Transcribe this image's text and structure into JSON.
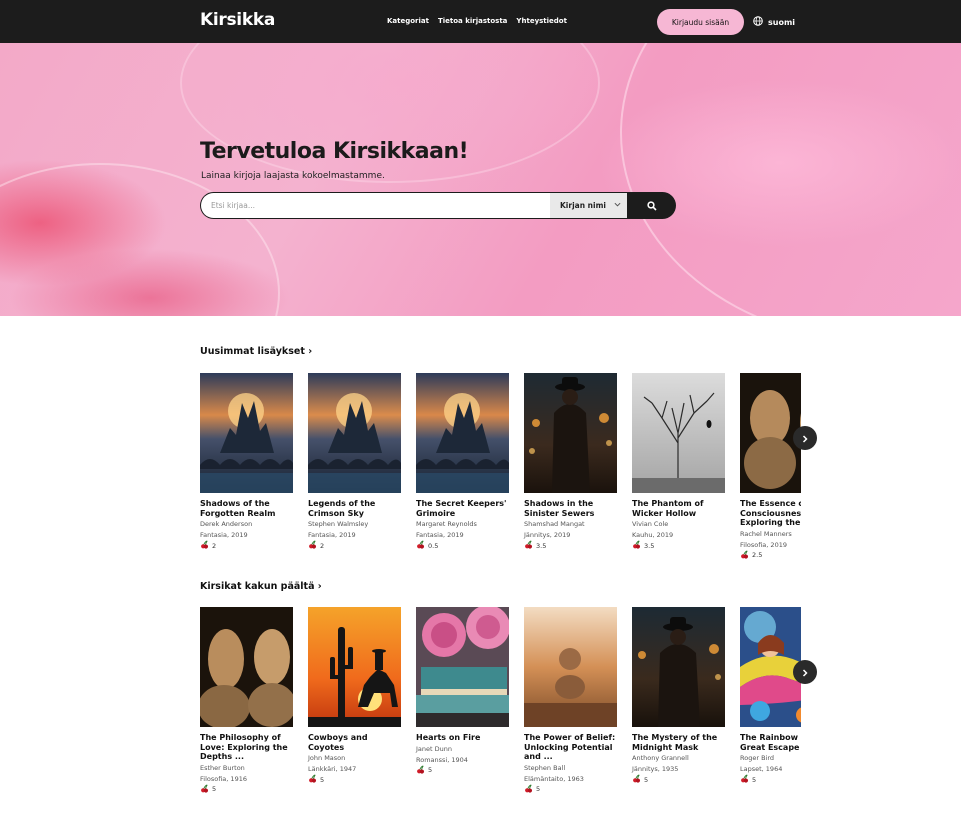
{
  "header": {
    "brand": "Kirsikka",
    "nav": [
      "Kategoriat",
      "Tietoa kirjastosta",
      "Yhteystiedot"
    ],
    "login_label": "Kirjaudu sisään",
    "language": "suomi"
  },
  "hero": {
    "title": "Tervetuloa Kirsikkaan!",
    "subtitle": "Lainaa kirjoja laajasta kokoelmastamme.",
    "search_placeholder": "Etsi kirjaa...",
    "search_filter": "Kirjan nimi"
  },
  "sections": [
    {
      "heading": "Uusimmat lisäykset ›",
      "books": [
        {
          "title": "Shadows of the\nForgotten Realm",
          "author": "Derek Anderson",
          "info": "Fantasia, 2019",
          "rating": "2"
        },
        {
          "title": "Legends of the\nCrimson Sky",
          "author": "Stephen Walmsley",
          "info": "Fantasia, 2019",
          "rating": "2"
        },
        {
          "title": "The Secret Keepers'\nGrimoire",
          "author": "Margaret Reynolds",
          "info": "Fantasia, 2019",
          "rating": "0.5"
        },
        {
          "title": "Shadows in the\nSinister Sewers",
          "author": "Shamshad Mangat",
          "info": "Jännitys, 2019",
          "rating": "3.5"
        },
        {
          "title": "The Phantom of\nWicker Hollow",
          "author": "Vivian Cole",
          "info": "Kauhu, 2019",
          "rating": "3.5"
        },
        {
          "title": "The Essence of\nConsciousness:\nExploring the D",
          "author": "Rachel Manners",
          "info": "Filosofia, 2019",
          "rating": "2.5"
        }
      ]
    },
    {
      "heading": "Kirsikat kakun päältä ›",
      "books": [
        {
          "title": "The Philosophy of\nLove: Exploring the\nDepths ...",
          "author": "Esther Burton",
          "info": "Filosofia, 1916",
          "rating": "5"
        },
        {
          "title": "Cowboys and Coyotes",
          "author": "John Mason",
          "info": "Länkkäri, 1947",
          "rating": "5"
        },
        {
          "title": "Hearts on Fire",
          "author": "Janet Dunn",
          "info": "Romanssi, 1904",
          "rating": "5"
        },
        {
          "title": "The Power of Belief:\nUnlocking Potential\nand ...",
          "author": "Stephen Ball",
          "info": "Elämäntaito, 1963",
          "rating": "5"
        },
        {
          "title": "The Mystery of the\nMidnight Mask",
          "author": "Anthony Grannell",
          "info": "Jännitys, 1935",
          "rating": "5"
        },
        {
          "title": "The Rainbow D\nGreat Escape",
          "author": "Roger Bird",
          "info": "Lapset, 1964",
          "rating": "5"
        }
      ]
    }
  ],
  "colors": {
    "header_bg": "#1c1c1c",
    "accent_pink": "#f6b7d4",
    "hero_pink": "#f3a9c8"
  },
  "icons": [
    "globe-icon",
    "search-icon",
    "cherry-icon",
    "chevron-right-icon"
  ]
}
